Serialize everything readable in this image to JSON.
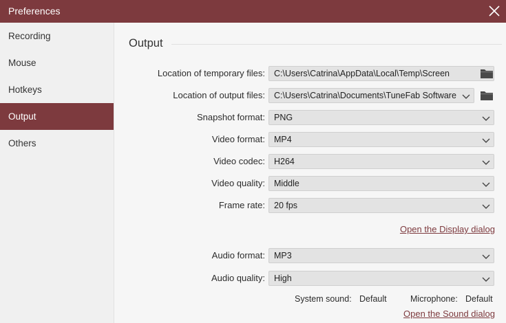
{
  "window": {
    "title": "Preferences",
    "close_icon": "close-icon",
    "accent_color": "#7d3a3e"
  },
  "sidebar": {
    "items": [
      {
        "label": "Recording",
        "active": false
      },
      {
        "label": "Mouse",
        "active": false
      },
      {
        "label": "Hotkeys",
        "active": false
      },
      {
        "label": "Output",
        "active": true
      },
      {
        "label": "Others",
        "active": false
      }
    ]
  },
  "output": {
    "section_title": "Output",
    "temp_location": {
      "label": "Location of temporary files:",
      "value": "C:\\Users\\Catrina\\AppData\\Local\\Temp\\Screen"
    },
    "output_location": {
      "label": "Location of output files:",
      "value": "C:\\Users\\Catrina\\Documents\\TuneFab Software"
    },
    "snapshot_format": {
      "label": "Snapshot format:",
      "value": "PNG"
    },
    "video_format": {
      "label": "Video format:",
      "value": "MP4"
    },
    "video_codec": {
      "label": "Video codec:",
      "value": "H264"
    },
    "video_quality": {
      "label": "Video quality:",
      "value": "Middle"
    },
    "frame_rate": {
      "label": "Frame rate:",
      "value": "20 fps"
    },
    "display_dialog_link": "Open the Display dialog",
    "audio_format": {
      "label": "Audio format:",
      "value": "MP3"
    },
    "audio_quality": {
      "label": "Audio quality:",
      "value": "High"
    },
    "system_sound": {
      "label": "System sound:",
      "value": "Default"
    },
    "microphone": {
      "label": "Microphone:",
      "value": "Default"
    },
    "sound_dialog_link": "Open the Sound dialog"
  }
}
